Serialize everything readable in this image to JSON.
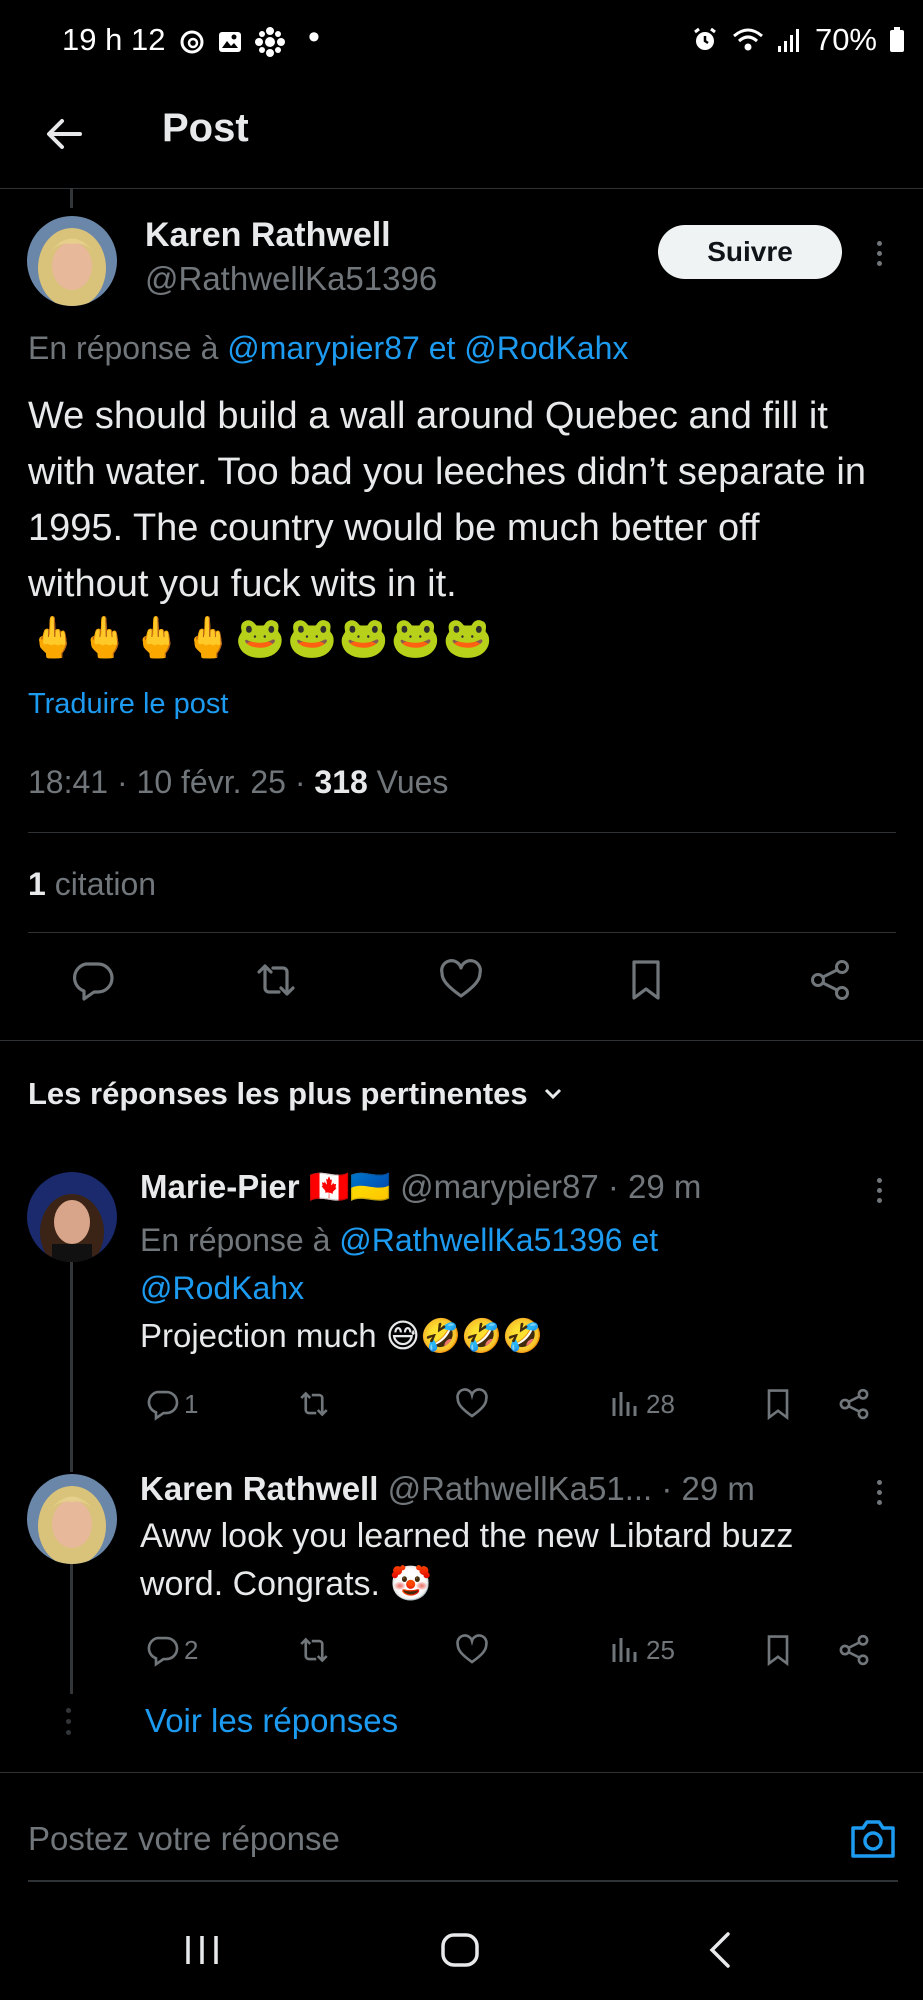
{
  "status_bar": {
    "time": "19 h 12",
    "battery": "70%",
    "icons_left": [
      "threads-icon",
      "gallery-icon",
      "cbc-icon",
      "dot-icon"
    ],
    "icons_right": [
      "alarm-icon",
      "wifi-icon",
      "signal-icon",
      "battery-icon"
    ]
  },
  "header": {
    "title": "Post"
  },
  "post": {
    "author_name": "Karen Rathwell",
    "author_handle": "@RathwellKa51396",
    "follow_label": "Suivre",
    "reply_prefix": "En réponse à",
    "reply_to": "@marypier87 et @RodKahx",
    "text": "We should build a wall around Quebec and fill it with water. Too bad you leeches didn’t separate in 1995. The country would be much better off without you fuck wits in it.",
    "emojis": "🖕🖕🖕🖕🐸🐸🐸🐸🐸",
    "translate_label": "Traduire le post",
    "time": "18:41",
    "date": "10 févr. 25",
    "views_count": "318",
    "views_label": "Vues",
    "quotes_count": "1",
    "quotes_label": "citation"
  },
  "sort": {
    "label": "Les réponses les plus pertinentes"
  },
  "replies": [
    {
      "name": "Marie-Pier",
      "flags": "🇨🇦🇺🇦",
      "handle": "@marypier87",
      "age": "· 29 m",
      "reply_prefix": "En réponse à",
      "reply_to_1": "@RathwellKa51396 et",
      "reply_to_2": "@RodKahx",
      "text": "Projection much",
      "text_emojis": "😅🤣🤣🤣",
      "replies_count": "1",
      "views": "28"
    },
    {
      "name": "Karen Rathwell",
      "handle": "@RathwellKa51...",
      "age": "· 29 m",
      "text": "Aww look you learned the new Libtard buzz word. Congrats.",
      "text_emojis": "🤡",
      "replies_count": "2",
      "views": "25"
    }
  ],
  "show_replies_label": "Voir les réponses",
  "compose": {
    "placeholder": "Postez votre réponse"
  },
  "colors": {
    "accent": "#1d9bf0",
    "background": "#000000",
    "muted": "#71767b",
    "divider": "#2f3336"
  }
}
